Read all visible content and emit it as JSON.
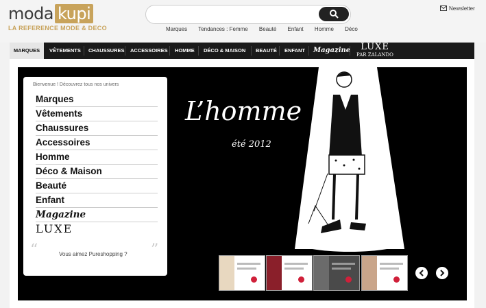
{
  "brand": {
    "name_part1": "moda",
    "name_part2": "kupi",
    "tagline": "LA REFERENCE MODE & DECO",
    "accent": "#c8a35b"
  },
  "search": {
    "placeholder": "",
    "icon": "search-icon"
  },
  "quick_links": [
    "Marques",
    "Tendances : Femme",
    "Beauté",
    "Enfant",
    "Homme",
    "Déco"
  ],
  "newsletter": {
    "label": "Newsletter",
    "icon": "envelope-icon"
  },
  "nav": {
    "items": [
      "MARQUES",
      "VÊTEMENTS",
      "CHAUSSURES",
      "ACCESSOIRES",
      "HOMME",
      "DÉCO & MAISON",
      "BEAUTÉ",
      "ENFANT",
      "Magazine"
    ],
    "luxe": {
      "title": "LUXE",
      "subtitle": "par ZALANDO"
    },
    "active": "MARQUES"
  },
  "sidebar": {
    "welcome": "Bienvenue ! Découvrez tous nos univers",
    "items": [
      "Marques",
      "Vêtements",
      "Chaussures",
      "Accessoires",
      "Homme",
      "Déco & Maison",
      "Beauté",
      "Enfant",
      "Magazine",
      "LUXE"
    ],
    "question": "Vous aimez Pureshopping ?"
  },
  "hero": {
    "title": "L’homme",
    "subtitle": "été 2012"
  },
  "carousel": {
    "prev_icon": "chevron-left-icon",
    "next_icon": "chevron-right-icon",
    "thumb_count": 4
  }
}
